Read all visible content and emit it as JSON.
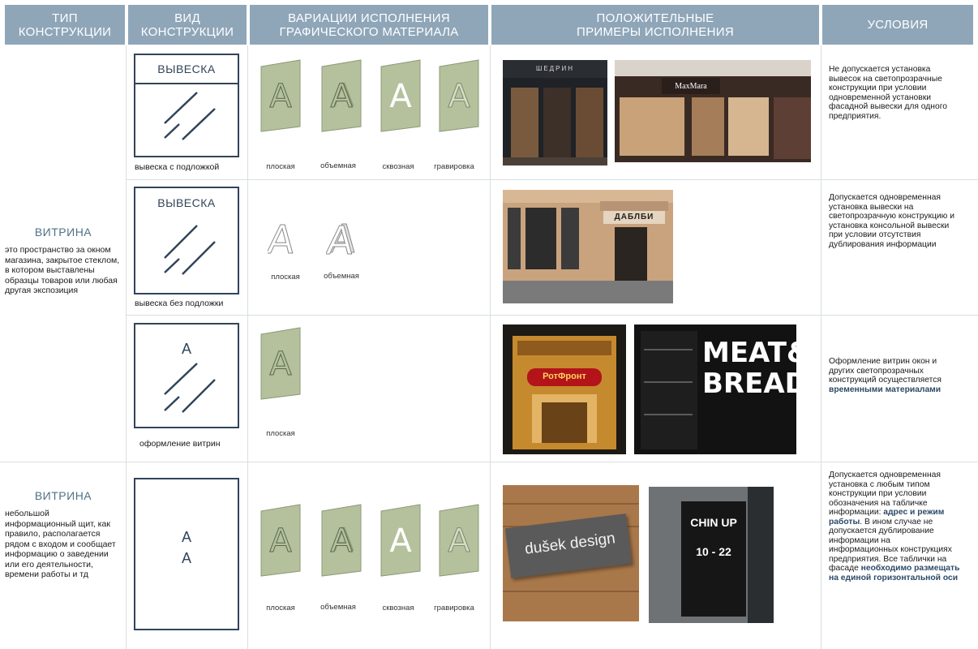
{
  "headers": [
    "ТИП\nКОНСТРУКЦИИ",
    "ВИД\nКОНСТРУКЦИИ",
    "ВАРИАЦИИ ИСПОЛНЕНИЯ\nГРАФИЧЕСКОГО МАТЕРИАЛА",
    "ПОЛОЖИТЕЛЬНЫЕ\nПРИМЕРЫ ИСПОЛНЕНИЯ",
    "УСЛОВИЯ"
  ],
  "types": [
    {
      "title": "ВИТРИНА",
      "desc": "это пространство за окном магазина, закрытое стеклом, в котором выставлены образцы товаров или любая другая экспозиция"
    },
    {
      "title": "ВИТРИНА",
      "desc": "небольшой информационный щит, как правило, располагается рядом с входом и сообщает информацию о заведении или его деятельности, времени работы и тд"
    }
  ],
  "rows": [
    {
      "frame_title": "ВЫВЕСКА",
      "caption": "вывеска с подложкой",
      "variants": [
        "плоская",
        "объемная",
        "сквозная",
        "гравировка"
      ],
      "photos": [
        {
          "sign": "ШЕДРИН",
          "colors": [
            "#2b2b2b",
            "#7a5a3e"
          ]
        },
        {
          "sign": "MaxMara",
          "colors": [
            "#3a2a24",
            "#c9a27a"
          ]
        }
      ],
      "condition": [
        {
          "t": "Не допускается установка вывесок на светопрозрачные конструкции при условии одновременной установки фасадной вывески для одного предприятия.",
          "hl": false
        }
      ]
    },
    {
      "frame_title": "ВЫВЕСКА",
      "caption": "вывеска без подложки",
      "variants": [
        "плоская",
        "объемная"
      ],
      "photos": [
        {
          "sign": "ДАБЛБИ",
          "colors": [
            "#c9a37e",
            "#5b4637"
          ]
        }
      ],
      "condition": [
        {
          "t": "Допускается одновременная установка вывески на светопрозрачную конструкцию и установка консольной вывески при условии отсутствия дублирования информации",
          "hl": false
        }
      ]
    },
    {
      "frame_title": "A",
      "caption": "оформление витрин",
      "variants": [
        "плоская"
      ],
      "photos": [
        {
          "sign": "РотФронт",
          "colors": [
            "#1d1a16",
            "#c58a2e"
          ]
        },
        {
          "sign": "MEAT& BREAD",
          "colors": [
            "#111111",
            "#1e1e1e"
          ]
        }
      ],
      "condition": [
        {
          "t": "Оформление витрин окон и других светопрозрачных конструкций осуществляется ",
          "hl": false
        },
        {
          "t": "временными материалами",
          "hl": true
        }
      ]
    },
    {
      "frame_title": "А\nА",
      "caption": "",
      "variants": [
        "плоская",
        "объемная",
        "сквозная",
        "гравировка"
      ],
      "photos": [
        {
          "sign": "dušek design",
          "colors": [
            "#a9784a",
            "#5a5a5a"
          ]
        },
        {
          "sign": "CHIN UP 10 - 22",
          "colors": [
            "#6f7275",
            "#161616"
          ]
        }
      ],
      "condition": [
        {
          "t": "Допускается одновременная установка с любым типом конструкции при условии обозначения на табличке информации: ",
          "hl": false
        },
        {
          "t": "адрес и режим работы",
          "hl": true
        },
        {
          "t": ". В ином случае не допускается дублирование информации на информационных конструкциях предприятия. Все таблички на фасаде ",
          "hl": false
        },
        {
          "t": "необходимо размещать на единой горизонтальной оси",
          "hl": true
        }
      ]
    }
  ],
  "plate_letter": "A",
  "colors": {
    "header": "#8fa6b9",
    "frame": "#31445a",
    "plate": "#b4c19c",
    "title": "#4f7186",
    "highlight": "#2c4a66"
  }
}
